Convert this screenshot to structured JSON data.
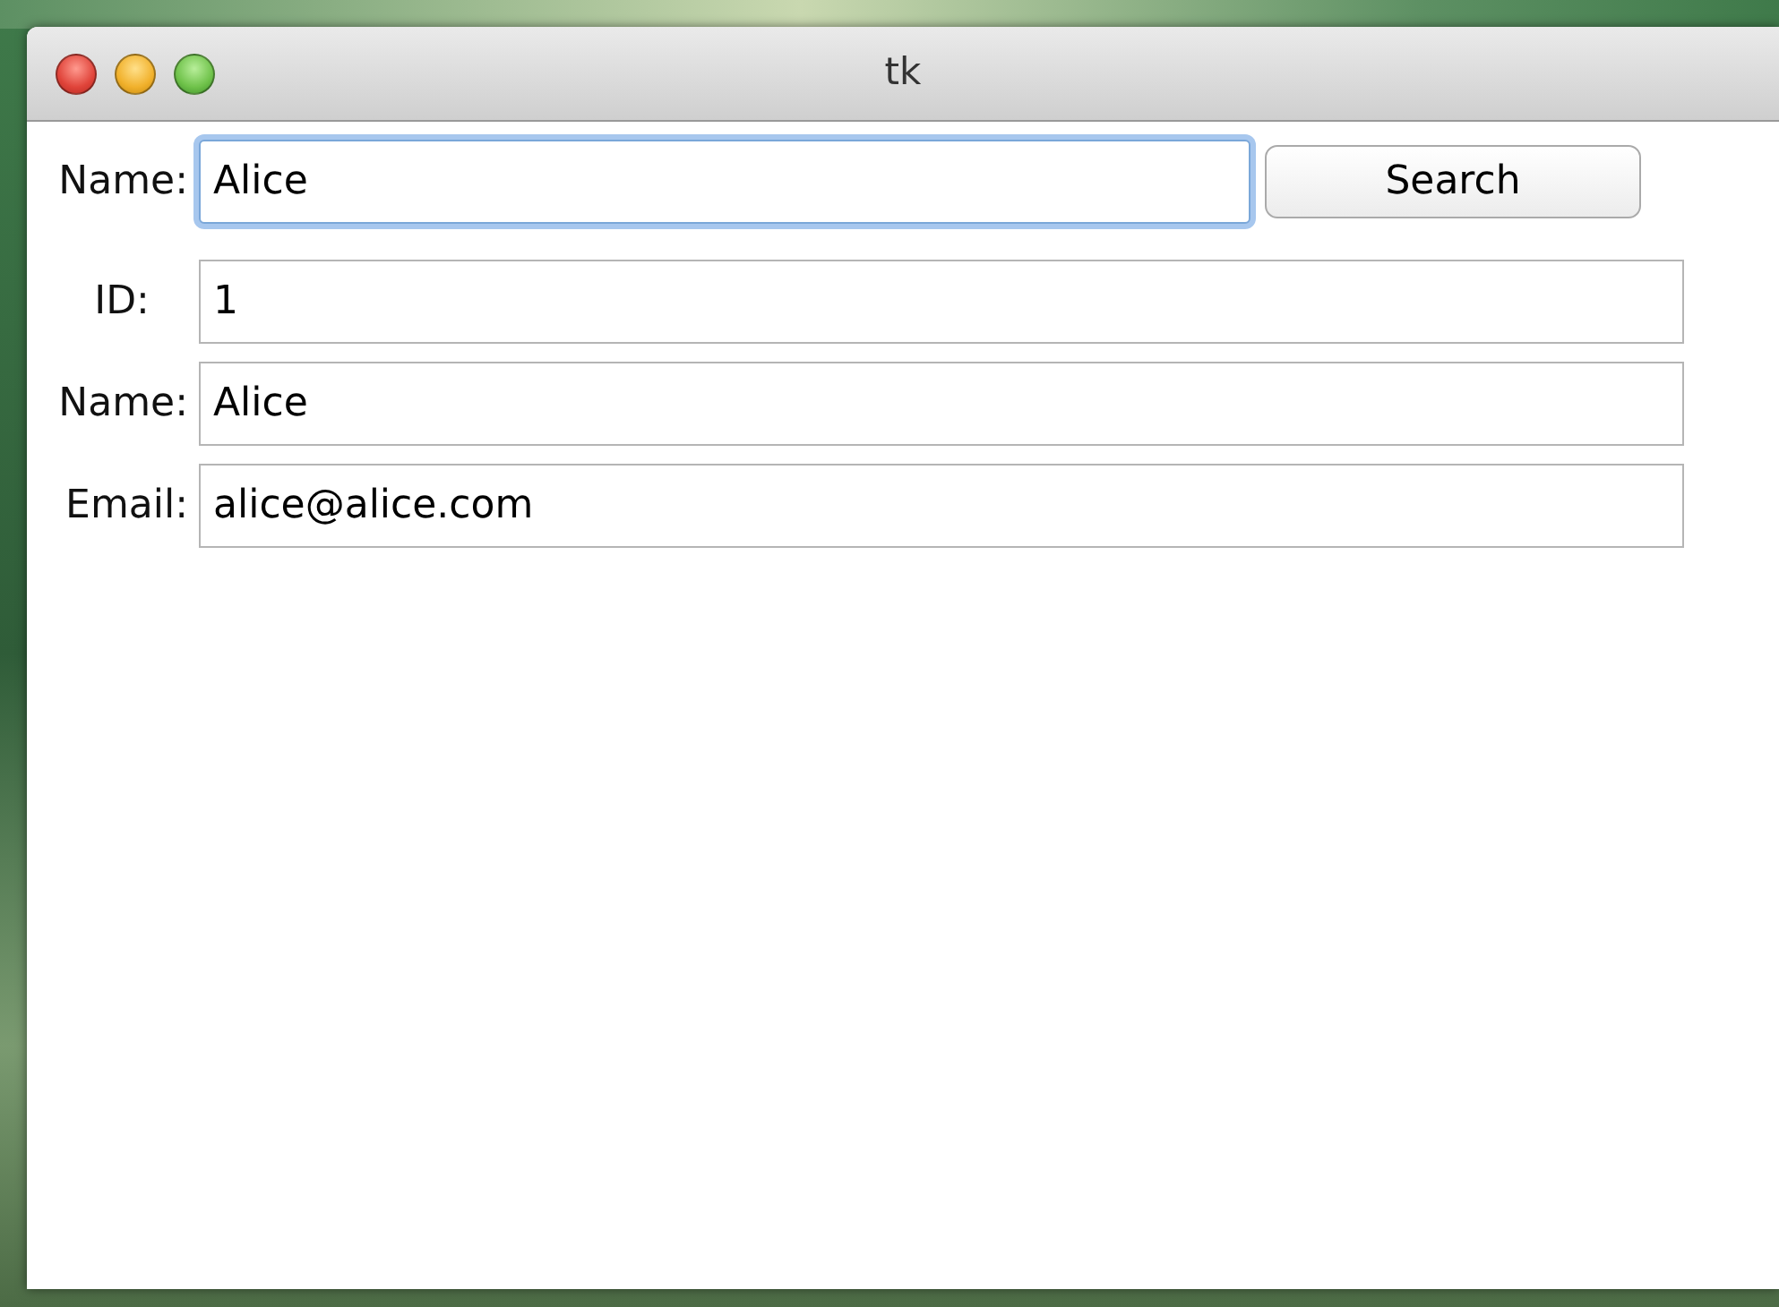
{
  "window": {
    "title": "tk"
  },
  "search": {
    "label": "Name:",
    "value": "Alice",
    "focused": true
  },
  "search_button": "Search",
  "fields": [
    {
      "label": "ID:",
      "value": "1"
    },
    {
      "label": "Name:",
      "value": "Alice"
    },
    {
      "label": "Email:",
      "value": "alice@alice.com"
    }
  ]
}
